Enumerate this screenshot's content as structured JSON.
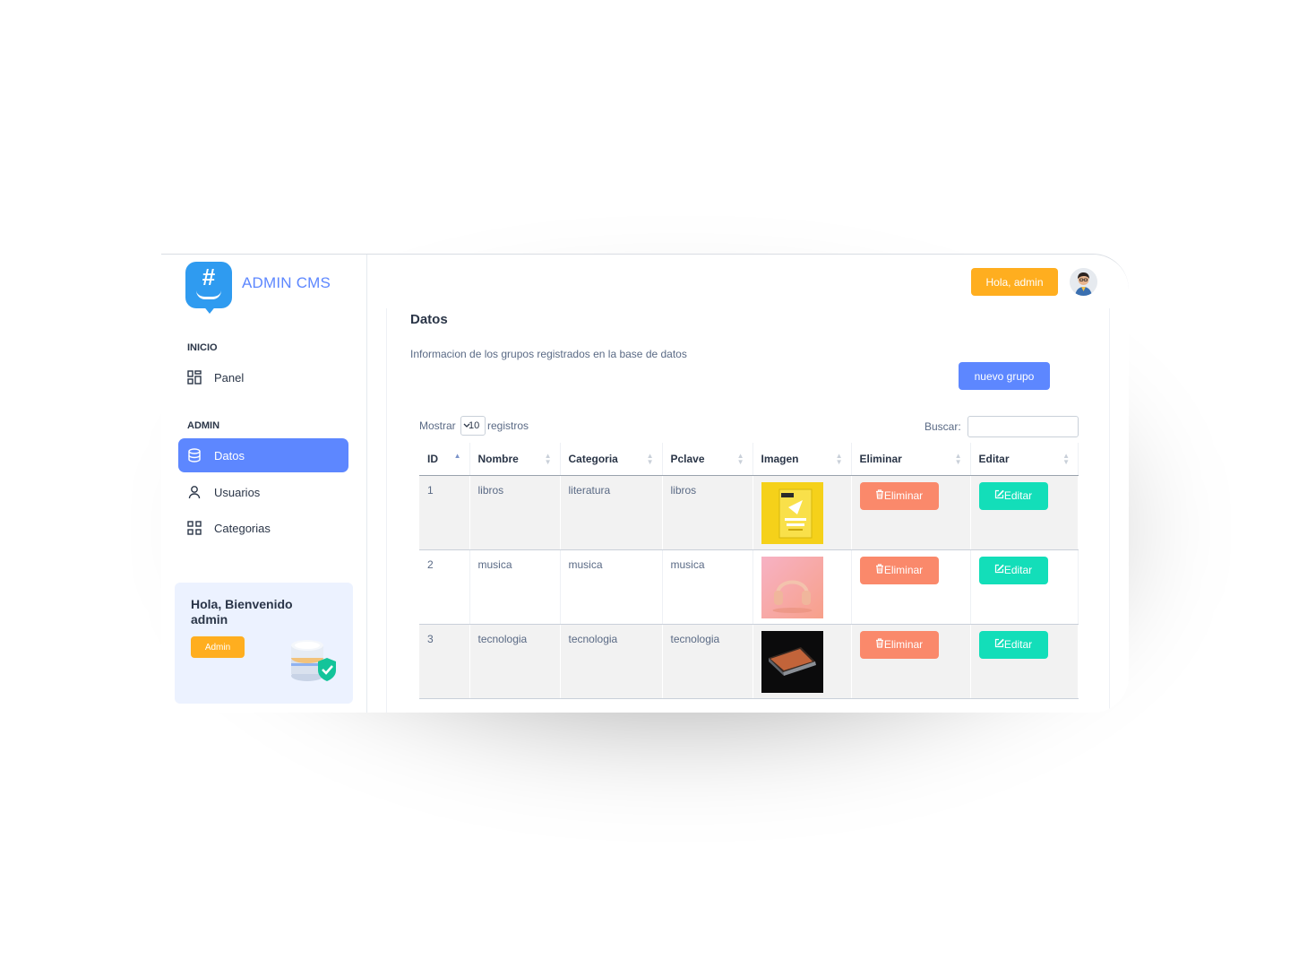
{
  "brand": {
    "name": "ADMIN CMS"
  },
  "sidebar": {
    "sections": [
      {
        "title": "INICIO",
        "items": [
          {
            "label": "Panel",
            "icon": "layout-dashboard-icon"
          }
        ]
      },
      {
        "title": "ADMIN",
        "items": [
          {
            "label": "Datos",
            "icon": "database-icon",
            "active": true
          },
          {
            "label": "Usuarios",
            "icon": "user-icon"
          },
          {
            "label": "Categorias",
            "icon": "layout-grid-icon"
          }
        ]
      }
    ],
    "welcome": {
      "text": "Hola, Bienvenido admin",
      "button": "Admin"
    }
  },
  "header": {
    "greeting_button": "Hola, admin"
  },
  "main": {
    "title": "Datos",
    "description": "Informacion de los grupos registrados en la base de datos",
    "new_button": "nuevo grupo",
    "length": {
      "prefix": "Mostrar",
      "value": "10",
      "suffix": "registros"
    },
    "search": {
      "label": "Buscar:",
      "value": ""
    },
    "table": {
      "columns": [
        "ID",
        "Nombre",
        "Categoria",
        "Pclave",
        "Imagen",
        "Eliminar",
        "Editar"
      ],
      "rows": [
        {
          "id": "1",
          "nombre": "libros",
          "categoria": "literatura",
          "pclave": "libros",
          "image": "book-cover",
          "delete": "Eliminar",
          "edit": "Editar"
        },
        {
          "id": "2",
          "nombre": "musica",
          "categoria": "musica",
          "pclave": "musica",
          "image": "headphones-photo",
          "delete": "Eliminar",
          "edit": "Editar"
        },
        {
          "id": "3",
          "nombre": "tecnologia",
          "categoria": "tecnologia",
          "pclave": "tecnologia",
          "image": "laptop-photo",
          "delete": "Eliminar",
          "edit": "Editar"
        }
      ]
    }
  },
  "colors": {
    "primary": "#5d87ff",
    "warning": "#ffae1f",
    "danger": "#fa896b",
    "success": "#13deb9",
    "logo": "#2f9bf0"
  }
}
